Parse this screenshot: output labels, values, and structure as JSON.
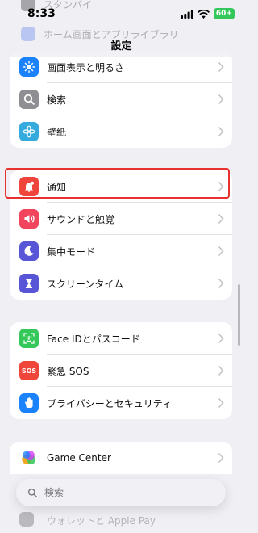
{
  "status_bar": {
    "time": "8:33",
    "battery": "60+"
  },
  "nav": {
    "title": "設定"
  },
  "ghost_rows": [
    "スタンバイ",
    "ホーム画面とアプリライブラリ"
  ],
  "group1": [
    {
      "label": "画面表示と明るさ",
      "icon": "sun-icon",
      "color": "#1a82fb"
    },
    {
      "label": "検索",
      "icon": "magnifier-icon",
      "color": "#8e8e93"
    },
    {
      "label": "壁紙",
      "icon": "flower-icon",
      "color": "#35aadc"
    }
  ],
  "group2": [
    {
      "label": "通知",
      "icon": "bell-icon",
      "color": "#f0453a"
    },
    {
      "label": "サウンドと触覚",
      "icon": "speaker-icon",
      "color": "#f0455d"
    },
    {
      "label": "集中モード",
      "icon": "moon-icon",
      "color": "#5856d6"
    },
    {
      "label": "スクリーンタイム",
      "icon": "hourglass-icon",
      "color": "#5856d6"
    }
  ],
  "group3": [
    {
      "label": "Face IDとパスコード",
      "icon": "faceid-icon",
      "color": "#34c759"
    },
    {
      "label": "緊急 SOS",
      "icon": "sos-icon",
      "color": "#f0453a",
      "icon_text": "SOS"
    },
    {
      "label": "プライバシーとセキュリティ",
      "icon": "hand-icon",
      "color": "#1a82fb"
    }
  ],
  "group4": [
    {
      "label": "Game Center",
      "icon": "game-center-icon",
      "color": "#ffffff"
    }
  ],
  "search": {
    "placeholder": "検索"
  },
  "bottom_ghost": {
    "label": "ウォレットと Apple Pay"
  }
}
